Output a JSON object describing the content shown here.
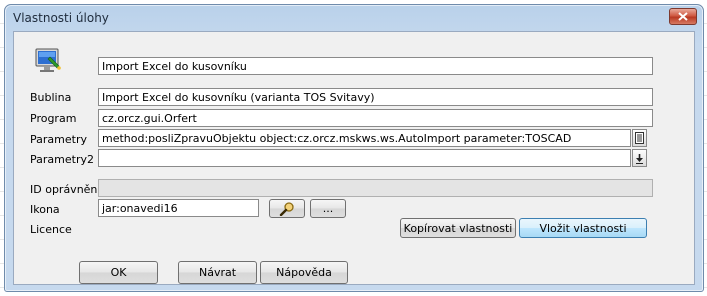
{
  "window": {
    "title": "Vlastnosti úlohy"
  },
  "icons": {
    "app": "monitor-icon",
    "close": "close-icon",
    "browse": "magnifier-icon",
    "parameter_editor": "list-editor-icon",
    "dropdown": "arrow-down-icon"
  },
  "form": {
    "name_value": "Import Excel do kusovníku",
    "bublina_label": "Bublina",
    "bublina_value": "Import Excel do kusovníku (varianta TOS Svitavy)",
    "program_label": "Program",
    "program_value": "cz.orcz.gui.Orfert",
    "parametry_label": "Parametry",
    "parametry_value": "method:posliZpravuObjektu object:cz.orcz.mskws.ws.AutoImport parameter:TOSCAD",
    "parametry2_label": "Parametry2",
    "parametry2_value": "",
    "id_label": "ID oprávnění",
    "id_value": "",
    "ikona_label": "Ikona",
    "ikona_value": "jar:onavedi16",
    "ellipsis_label": "...",
    "licence_label": "Licence"
  },
  "buttons": {
    "copy_props": "Kopírovat vlastnosti",
    "paste_props": "Vložit vlastnosti",
    "ok": "OK",
    "back": "Návrat",
    "help": "Nápověda"
  },
  "colors": {
    "title_bar": "#c6d9ee",
    "close_button": "#cf5a43",
    "client_bg": "#f0f0f0",
    "focus_button": "#bee6fd"
  }
}
